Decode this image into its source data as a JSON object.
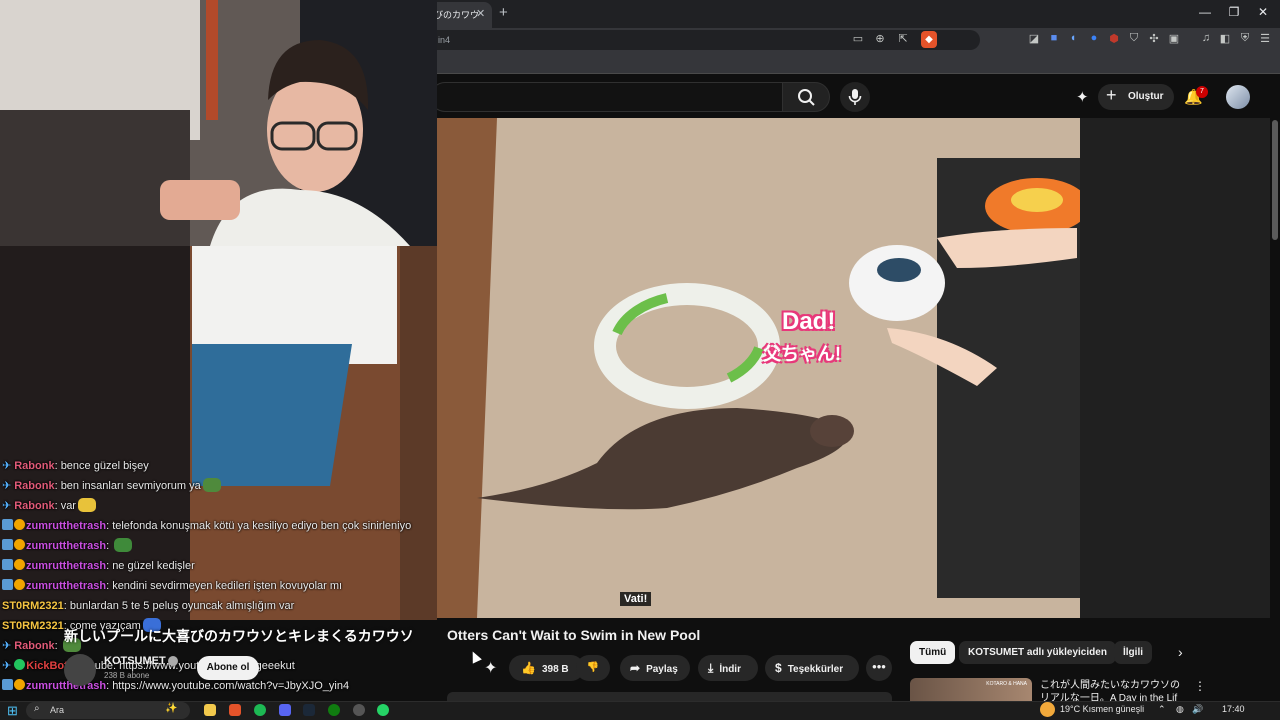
{
  "browser": {
    "tab_title": "びのカワウ",
    "tab_close": "✕",
    "new_tab": "+",
    "url_fragment": "in4",
    "window_controls": [
      "—",
      "❐",
      "✕"
    ]
  },
  "youtube": {
    "create_label": "Oluştur",
    "notification_count": "7"
  },
  "video": {
    "caption": "Vati!",
    "title": "Otters Can't Wait to Swim in New Pool",
    "overlay_title_jp": "新しいプールに大喜びのカワウソとキレまくるカワウソ",
    "in_video_text": {
      "dad": "Dad!",
      "jp": "父ちゃん!"
    }
  },
  "channel": {
    "name": "KOTSUMET",
    "subs": "238 B abone",
    "subscribe_label": "Abone ol"
  },
  "actions": {
    "likes": "398 B",
    "share": "Paylaş",
    "download": "İndir",
    "thanks": "Teşekkürler",
    "more": "•••"
  },
  "chips": [
    "Tümü",
    "KOTSUMET adlı yükleyiciden",
    "İlgili"
  ],
  "recommendation": {
    "title": "これが人間みたいなカワウソのリアルな一日。A Day in the Lif",
    "thumb_text": "KOTARO & HANA"
  },
  "chat": [
    {
      "badges": [
        "pin"
      ],
      "user": "Rabonk",
      "color": "#e05a78",
      "text": "bence güzel bişey",
      "emote": null
    },
    {
      "badges": [
        "pin"
      ],
      "user": "Rabonk",
      "color": "#e05a78",
      "text": "ben insanları sevmiyorum ya",
      "emote": "#4f8a3c"
    },
    {
      "badges": [
        "pin"
      ],
      "user": "Rabonk",
      "color": "#e05a78",
      "text": "var",
      "emote": "#e8c23a"
    },
    {
      "badges": [
        "sub",
        "one"
      ],
      "user": "zumrutthetrash",
      "color": "#c94fe0",
      "text": "telefonda konuşmak kötü ya kesiliyo ediyo ben çok sinirleniyo",
      "emote": null
    },
    {
      "badges": [
        "sub",
        "one"
      ],
      "user": "zumrutthetrash",
      "color": "#c94fe0",
      "text": "",
      "emote": "#3f8a3a"
    },
    {
      "badges": [
        "sub",
        "one"
      ],
      "user": "zumrutthetrash",
      "color": "#c94fe0",
      "text": "ne güzel kedişler",
      "emote": null
    },
    {
      "badges": [
        "sub",
        "one"
      ],
      "user": "zumrutthetrash",
      "color": "#c94fe0",
      "text": "kendini sevdirmeyen kedileri işten kovuyolar mı",
      "emote": null
    },
    {
      "badges": [],
      "user": "ST0RM2321",
      "color": "#f5c542",
      "text": "bunlardan 5 te 5 peluş oyuncak almışlığım var",
      "emote": null
    },
    {
      "badges": [],
      "user": "ST0RM2321",
      "color": "#f5c542",
      "text": "çome yazıçam",
      "emote": "#3a6fd8"
    },
    {
      "badges": [
        "pin"
      ],
      "user": "Rabonk",
      "color": "#e05a78",
      "text": "",
      "emote": "#4f8a3c"
    },
    {
      "badges": [
        "pin",
        "chk"
      ],
      "user": "KickBot",
      "color": "#e04040",
      "text": "youtube: https://www.youtube.com/@geeekut",
      "emote": null
    },
    {
      "badges": [
        "sub",
        "one"
      ],
      "user": "zumrutthetrash",
      "color": "#c94fe0",
      "text": "https://www.youtube.com/watch?v=JbyXJO_yin4",
      "emote": null
    }
  ],
  "taskbar": {
    "search_placeholder": "Ara",
    "weather": "19°C  Kısmen güneşli",
    "time": "17:40"
  },
  "colors": {
    "background": "#0f0f0f",
    "accent_red": "#cc0000",
    "chat_pin": "#56b2ff"
  }
}
